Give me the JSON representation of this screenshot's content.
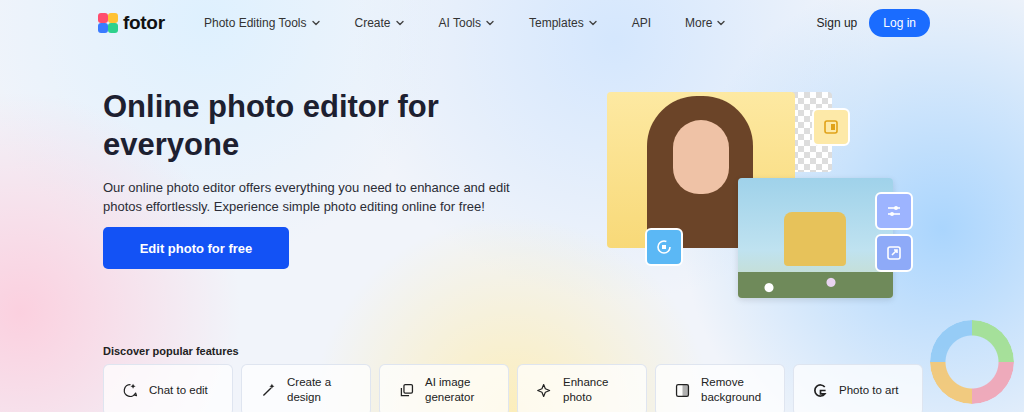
{
  "logo": {
    "text": "fotor"
  },
  "nav": {
    "items": [
      {
        "label": "Photo Editing Tools",
        "dropdown": true
      },
      {
        "label": "Create",
        "dropdown": true
      },
      {
        "label": "AI Tools",
        "dropdown": true
      },
      {
        "label": "Templates",
        "dropdown": true
      },
      {
        "label": "API",
        "dropdown": false
      },
      {
        "label": "More",
        "dropdown": true
      }
    ],
    "sign_up": "Sign up",
    "log_in": "Log in"
  },
  "hero": {
    "title": "Online photo editor for everyone",
    "description": "Our online photo editor offers everything you need to enhance and edit photos effortlessly. Experience simple photo editing online for free!",
    "cta": "Edit photo for free"
  },
  "features": {
    "label": "Discover popular features",
    "items": [
      {
        "label": "Chat to edit"
      },
      {
        "label": "Create a design"
      },
      {
        "label": "AI image generator"
      },
      {
        "label": "Enhance photo"
      },
      {
        "label": "Remove background"
      },
      {
        "label": "Photo to art"
      }
    ]
  }
}
